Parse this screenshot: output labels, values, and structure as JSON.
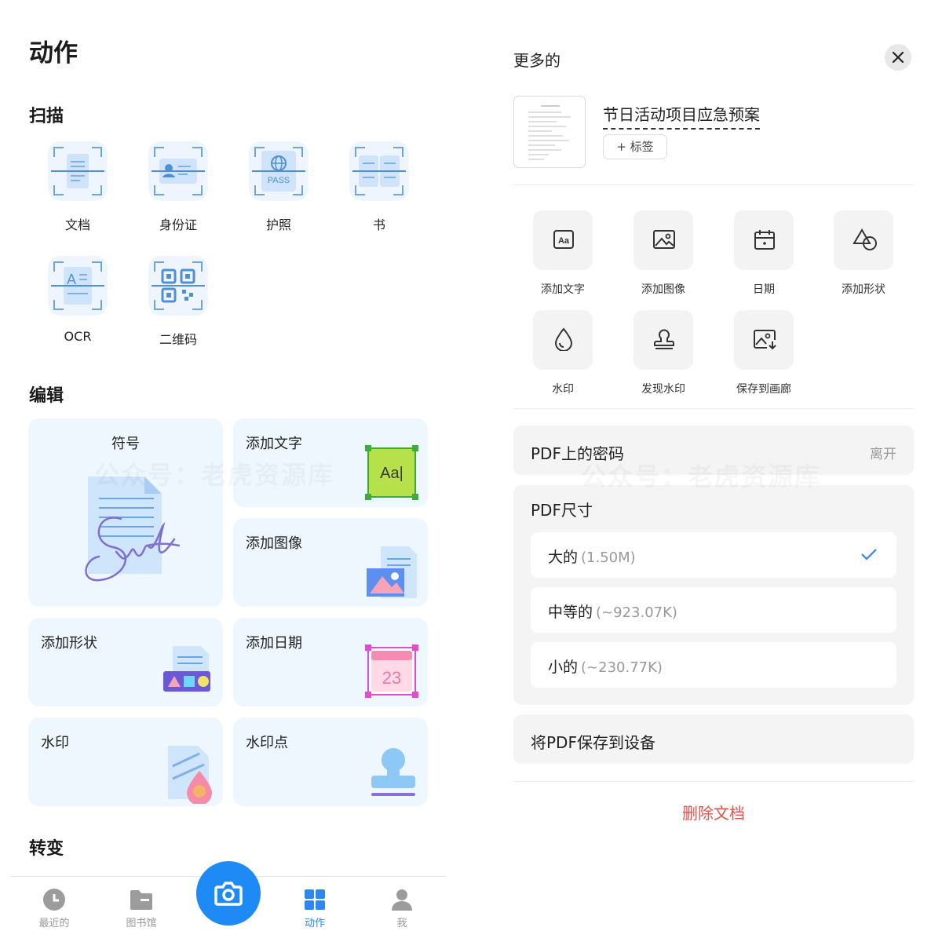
{
  "left": {
    "title": "动作",
    "scan": {
      "title": "扫描",
      "items": [
        {
          "label": "文档",
          "icon": "document-scan-icon"
        },
        {
          "label": "身份证",
          "icon": "id-card-scan-icon"
        },
        {
          "label": "护照",
          "icon": "passport-scan-icon"
        },
        {
          "label": "书",
          "icon": "book-scan-icon"
        },
        {
          "label": "OCR",
          "icon": "ocr-scan-icon"
        },
        {
          "label": "二维码",
          "icon": "qr-code-scan-icon"
        }
      ],
      "passport_text": "PASS"
    },
    "edit": {
      "title": "编辑",
      "cards": [
        {
          "label": "符号",
          "icon": "signature-icon"
        },
        {
          "label": "添加文字",
          "icon": "add-text-icon",
          "icon_text": "Aa|"
        },
        {
          "label": "添加图像",
          "icon": "add-image-icon"
        },
        {
          "label": "添加形状",
          "icon": "add-shape-icon"
        },
        {
          "label": "添加日期",
          "icon": "add-date-icon",
          "icon_text": "23"
        },
        {
          "label": "水印",
          "icon": "watermark-icon"
        },
        {
          "label": "水印点",
          "icon": "stamp-icon"
        }
      ]
    },
    "convert": {
      "title": "转变"
    },
    "nav": [
      {
        "label": "最近的",
        "icon": "clock-icon",
        "active": false
      },
      {
        "label": "图书馆",
        "icon": "folder-icon",
        "active": false
      },
      {
        "label": "动作",
        "icon": "grid-icon",
        "active": true
      },
      {
        "label": "我",
        "icon": "person-icon",
        "active": false
      }
    ],
    "watermark_text": "公众号：老虎资源库"
  },
  "right": {
    "title": "更多的",
    "document": {
      "name": "节日活动项目应急预案",
      "tag_button": "+ 标签"
    },
    "actions": [
      {
        "label": "添加文字",
        "icon": "text-box-icon"
      },
      {
        "label": "添加图像",
        "icon": "image-icon"
      },
      {
        "label": "日期",
        "icon": "calendar-icon"
      },
      {
        "label": "添加形状",
        "icon": "shapes-icon"
      },
      {
        "label": "水印",
        "icon": "drop-icon"
      },
      {
        "label": "发现水印",
        "icon": "stamp-outline-icon"
      },
      {
        "label": "保存到画廊",
        "icon": "save-image-icon"
      }
    ],
    "password": {
      "label": "PDF上的密码",
      "value": "离开"
    },
    "size": {
      "title": "PDF尺寸",
      "options": [
        {
          "name": "大的",
          "size": "(1.50M)",
          "selected": true
        },
        {
          "name": "中等的",
          "size": "(~923.07K)",
          "selected": false
        },
        {
          "name": "小的",
          "size": "(~230.77K)",
          "selected": false
        }
      ]
    },
    "save_to_device": "将PDF保存到设备",
    "delete": "删除文档",
    "watermark_text": "公众号：老虎资源库"
  },
  "colors": {
    "accent": "#1d8af5",
    "delete": "#e0544d",
    "card_bg": "#eef6fe"
  }
}
